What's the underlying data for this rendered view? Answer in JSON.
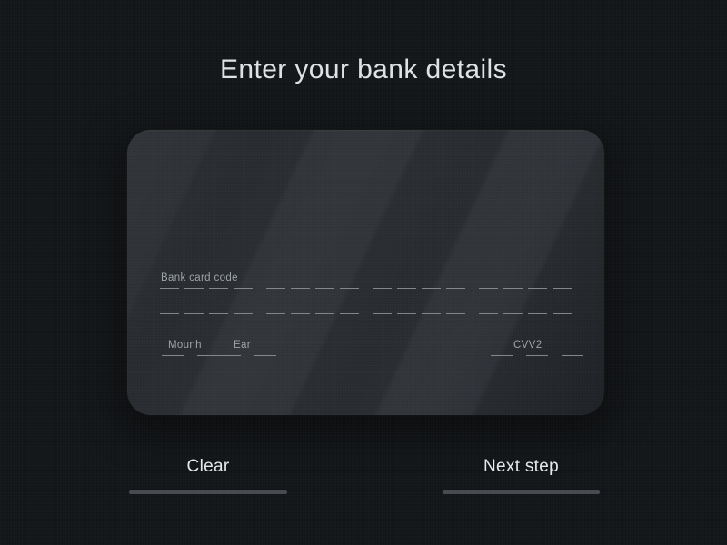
{
  "page": {
    "title": "Enter your bank details",
    "background_color": "#131619"
  },
  "card": {
    "surface_color": "#2a2e32",
    "fields": [
      {
        "id": "bank-card-code",
        "label": "Bank card code",
        "groups": 4,
        "dashes_per_group": 4,
        "rows": 2,
        "value": ""
      },
      {
        "id": "month",
        "label": "Mounh",
        "groups": 2,
        "dashes_per_group": 1,
        "rows": 2,
        "value": ""
      },
      {
        "id": "year",
        "label": "Ear",
        "groups": 2,
        "dashes_per_group": 1,
        "rows": 2,
        "value": ""
      },
      {
        "id": "cvv2",
        "label": "CVV2",
        "groups": 3,
        "dashes_per_group": 1,
        "rows": 2,
        "value": ""
      }
    ]
  },
  "actions": {
    "clear_label": "Clear",
    "next_label": "Next step",
    "underline_color": "#46494d"
  }
}
